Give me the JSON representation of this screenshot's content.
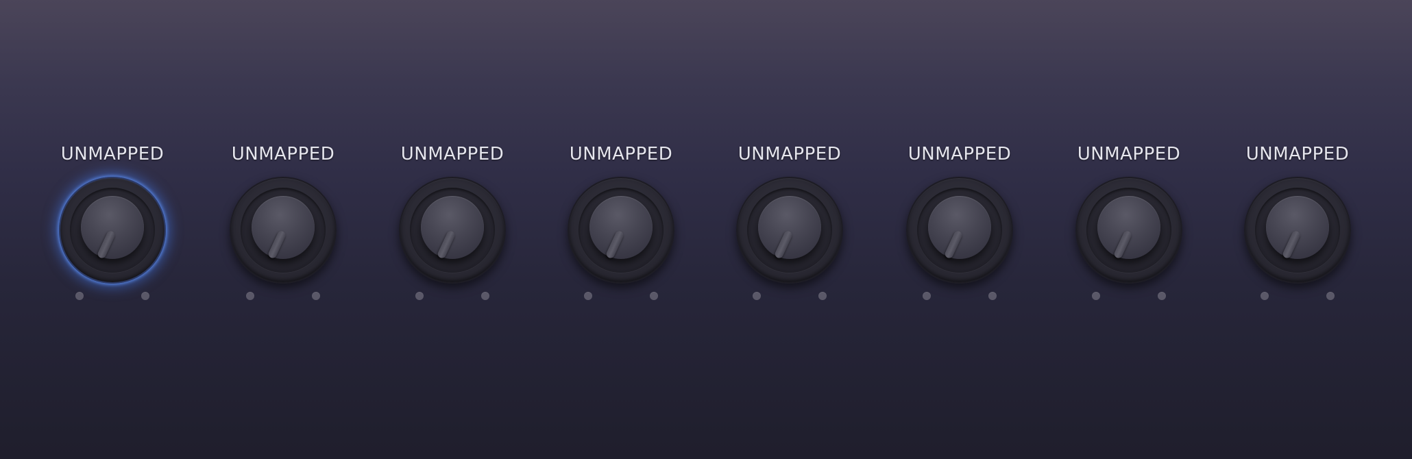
{
  "knobs": [
    {
      "label": "UNMAPPED",
      "active": true
    },
    {
      "label": "UNMAPPED",
      "active": false
    },
    {
      "label": "UNMAPPED",
      "active": false
    },
    {
      "label": "UNMAPPED",
      "active": false
    },
    {
      "label": "UNMAPPED",
      "active": false
    },
    {
      "label": "UNMAPPED",
      "active": false
    },
    {
      "label": "UNMAPPED",
      "active": false
    },
    {
      "label": "UNMAPPED",
      "active": false
    }
  ],
  "colors": {
    "active_glow": "#4678e6",
    "label": "#e6e6ee",
    "indicator_dot": "#5a5868"
  }
}
